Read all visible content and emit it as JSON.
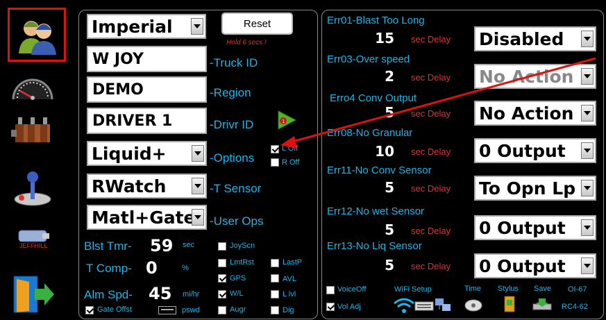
{
  "sidebar": {
    "items": [
      {
        "name": "users",
        "selected": true
      },
      {
        "name": "gauge"
      },
      {
        "name": "valve"
      },
      {
        "name": "joystick"
      },
      {
        "name": "usb",
        "label": "JEFFHILL"
      },
      {
        "name": "exit"
      }
    ]
  },
  "left": {
    "units": "Imperial",
    "reset_label": "Reset",
    "reset_hint": "Hold 6 secs !",
    "truck_id": "W JOY",
    "truck_id_label": "-Truck ID",
    "region": "DEMO",
    "region_label": "-Region",
    "driver_id": "DRIVER 1",
    "driver_id_label": "-Drivr ID",
    "options": "Liquid+",
    "options_label": "-Options",
    "l_off": "L Off",
    "r_off": "R Off",
    "t_sensor": "RWatch",
    "t_sensor_label": "-T Sensor",
    "user_ops": "Matl+Gate",
    "user_ops_label": "-User Ops",
    "blst_tmr_label": "Blst Tmr-",
    "blst_tmr_value": "59",
    "blst_tmr_unit": "sec",
    "t_comp_label": "T Comp-",
    "t_comp_value": "0",
    "t_comp_unit": "%",
    "alm_spd_label": "Alm Spd-",
    "alm_spd_value": "45",
    "alm_spd_unit": "mi/hr",
    "gate_offst": "Gate Offst",
    "pswd": "pswd",
    "checks": {
      "joyscn": "JoyScn",
      "lmtrst": "LmtRst",
      "lastp": "LastP",
      "gps": "GPS",
      "avl": "AVL",
      "wl": "W/L",
      "llvl": "L lvl",
      "augr": "Augr",
      "dig": "Dig"
    }
  },
  "right": {
    "errors": [
      {
        "title": "Err01-Blast Too Long",
        "delay": "15",
        "delay_label": "sec Delay",
        "action": "Disabled"
      },
      {
        "title": "Err03-Over speed",
        "delay": "2",
        "delay_label": "sec Delay",
        "action": "No Action"
      },
      {
        "title": "Erro4 Conv Output",
        "delay": "5",
        "delay_label": "sec Delay",
        "action": "No Action"
      },
      {
        "title": "Err08-No Granular",
        "delay": "10",
        "delay_label": "sec Delay",
        "action": "0 Output"
      },
      {
        "title": "Err11-No Conv Sensor",
        "delay": "5",
        "delay_label": "sec Delay",
        "action": "To Opn Lp"
      },
      {
        "title": "Err12-No wet Sensor",
        "delay": "5",
        "delay_label": "sec Delay",
        "action": "0 Output"
      },
      {
        "title": "Err13-No Liq Sensor",
        "delay": "5",
        "delay_label": "sec Delay",
        "action": "0 Output"
      }
    ],
    "voice_off": "VoiceOff",
    "vol_adj": "Vol Adj",
    "wifi_setup": "WiFi Setup",
    "time": "Time",
    "stylus": "Stylus",
    "save": "Save",
    "oi": "OI-67",
    "rc": "RC4-62"
  },
  "colors": {
    "accent": "#19b6ea",
    "delay": "#e03030",
    "selection": "#e01010",
    "arrow": "#e01010"
  }
}
